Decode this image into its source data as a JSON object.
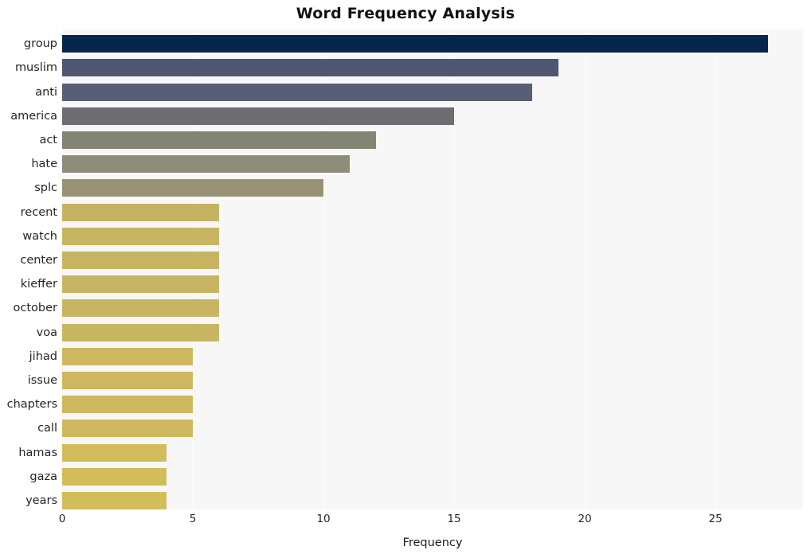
{
  "chart_data": {
    "type": "bar",
    "orientation": "horizontal",
    "title": "Word Frequency Analysis",
    "xlabel": "Frequency",
    "ylabel": "",
    "categories": [
      "group",
      "muslim",
      "anti",
      "america",
      "act",
      "hate",
      "splc",
      "recent",
      "watch",
      "center",
      "kieffer",
      "october",
      "voa",
      "jihad",
      "issue",
      "chapters",
      "call",
      "hamas",
      "gaza",
      "years"
    ],
    "values": [
      27,
      19,
      18,
      15,
      12,
      11,
      10,
      6,
      6,
      6,
      6,
      6,
      6,
      5,
      5,
      5,
      5,
      4,
      4,
      4
    ],
    "bar_colors": [
      "#07254d",
      "#4f5671",
      "#595e74",
      "#6c6d71",
      "#848472",
      "#8f8d79",
      "#979276",
      "#c5b364",
      "#c7b563",
      "#c7b462",
      "#c8b563",
      "#c8b562",
      "#c8b562",
      "#cdb85f",
      "#cdb85f",
      "#cdb85f",
      "#ceb95f",
      "#d2bc5b",
      "#d3bd5b",
      "#d3bd5b"
    ],
    "xticks": [
      0,
      5,
      10,
      15,
      20,
      25
    ],
    "xlim": [
      0,
      28.35
    ],
    "grid": true,
    "gridlines_axis": "x",
    "legend": "none",
    "plot_background": "#f7f7f7",
    "figure_background": "#ffffff",
    "gridline_color": "#ffffff",
    "text_color": "#262626"
  }
}
